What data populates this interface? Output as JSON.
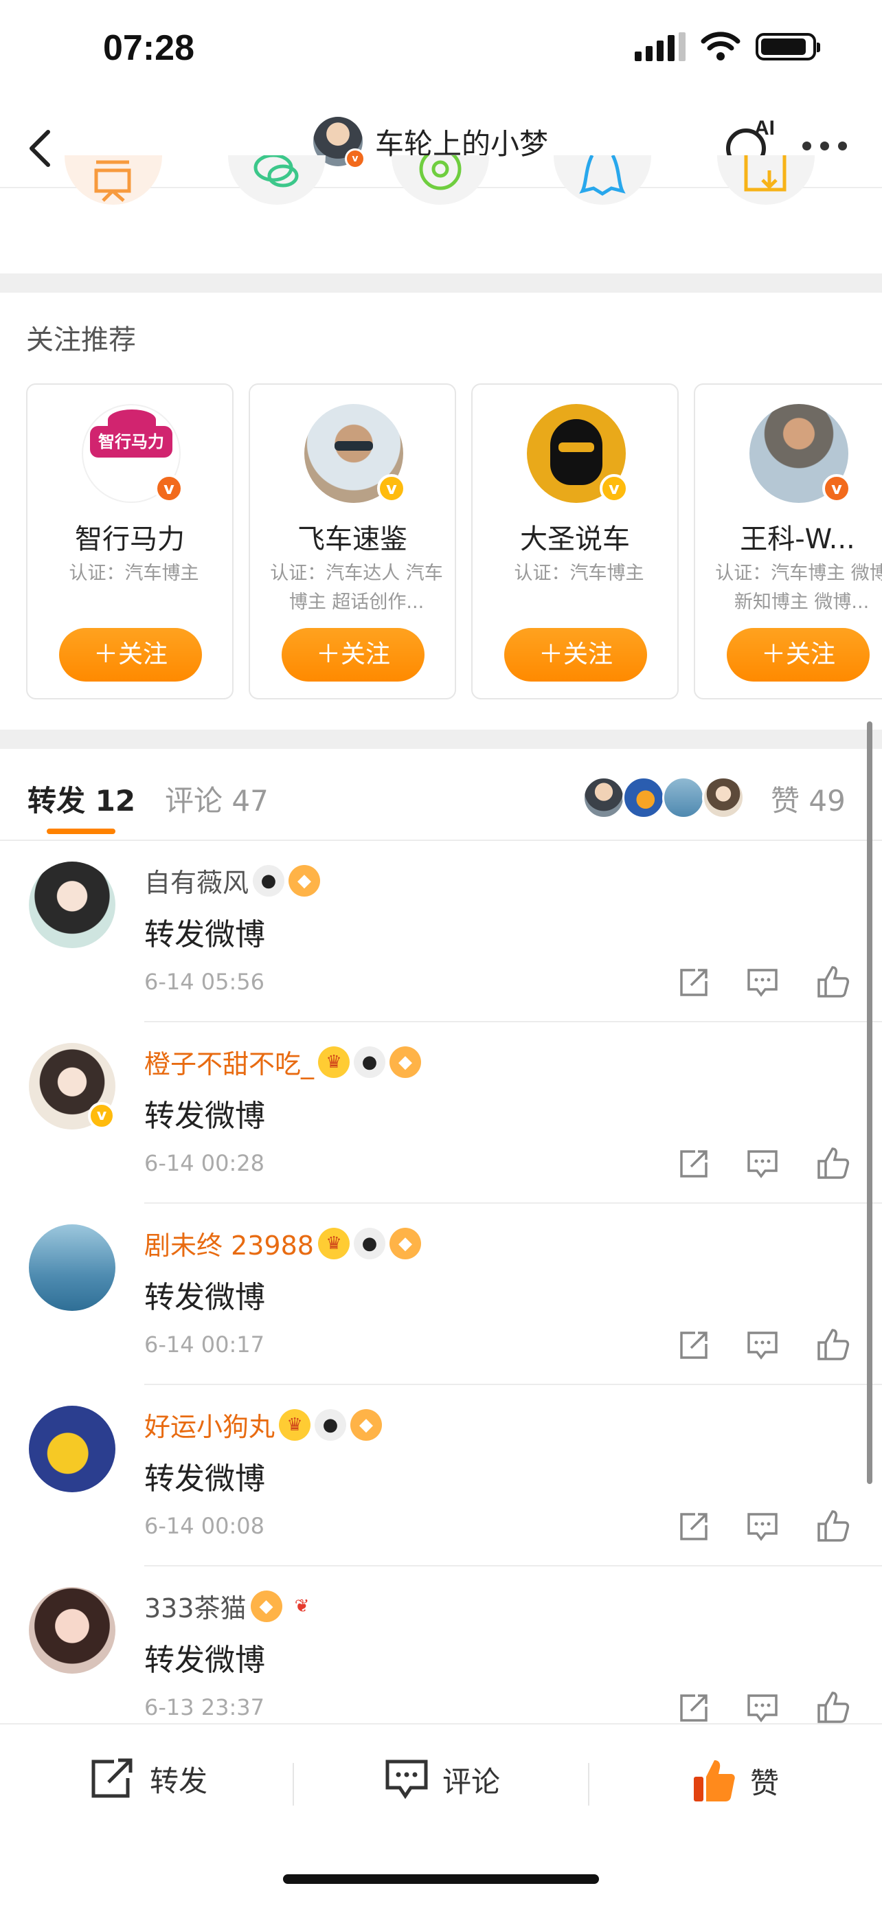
{
  "status_bar": {
    "time": "07:28"
  },
  "nav": {
    "title": "车轮上的小梦",
    "ai_label": "AI"
  },
  "recommend": {
    "title": "关注推荐",
    "cards": [
      {
        "name": "智行马力",
        "desc": "认证：汽车博主",
        "follow": "＋关注",
        "avatar_text": "智行马力"
      },
      {
        "name": "飞车速鉴",
        "desc": "认证：汽车达人 汽车博主 超话创作...",
        "follow": "＋关注"
      },
      {
        "name": "大圣说车",
        "desc": "认证：汽车博主",
        "follow": "＋关注"
      },
      {
        "name": "王科-W...",
        "desc": "认证：汽车博主 微博新知博主 微博...",
        "follow": "＋关注"
      }
    ]
  },
  "tabs": {
    "repost": "转发 12",
    "comment": "评论 47",
    "like": "赞 49"
  },
  "reposts": [
    {
      "name": "自有薇风",
      "text": "转发微博",
      "time": "6-14 05:56",
      "vip": false
    },
    {
      "name": "橙子不甜不吃_",
      "text": "转发微博",
      "time": "6-14 00:28",
      "vip": true
    },
    {
      "name": "剧未终 23988",
      "text": "转发微博",
      "time": "6-14 00:17",
      "vip": true
    },
    {
      "name": "好运小狗丸",
      "text": "转发微博",
      "time": "6-14 00:08",
      "vip": true
    },
    {
      "name": "333茶猫",
      "text": "转发微博",
      "time": "6-13 23:37",
      "vip": false
    }
  ],
  "bottom_bar": {
    "repost": "转发",
    "comment": "评论",
    "like": "赞"
  },
  "colors": {
    "accent": "#ff8200",
    "vip_name": "#e86b11",
    "badge": "#ffbb0d"
  }
}
